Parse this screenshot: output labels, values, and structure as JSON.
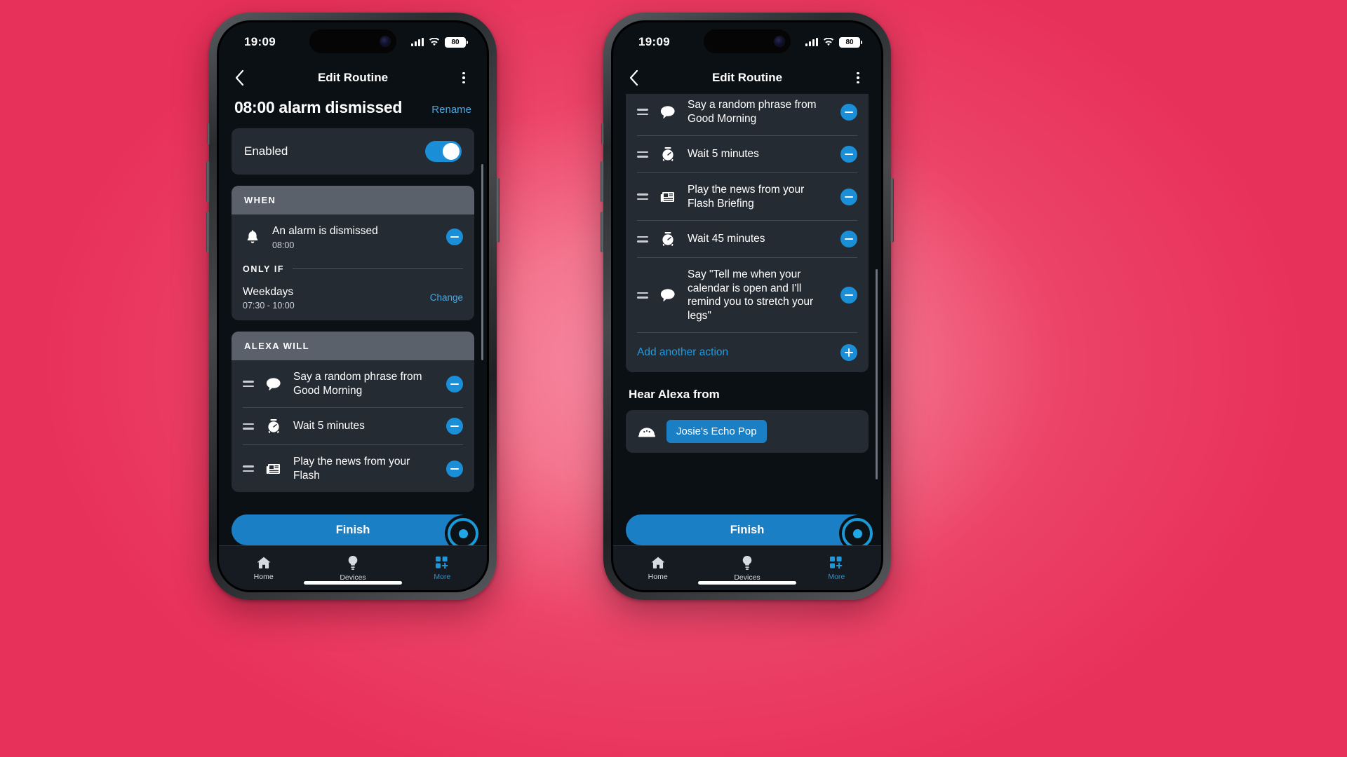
{
  "status_bar": {
    "time": "19:09",
    "battery": "80",
    "signal_icon": "cellular-signal-icon",
    "wifi_icon": "wifi-icon"
  },
  "nav": {
    "title": "Edit Routine",
    "back_icon": "back-chevron-icon",
    "more_icon": "overflow-menu-icon"
  },
  "left_phone": {
    "routine_name": "08:00 alarm dismissed",
    "rename_label": "Rename",
    "enabled": {
      "label": "Enabled",
      "state": "on"
    },
    "when": {
      "header": "WHEN",
      "trigger": {
        "icon": "bell-icon",
        "title": "An alarm is dismissed",
        "subtitle": "08:00",
        "remove_label": "−"
      },
      "only_if_header": "ONLY IF",
      "condition": {
        "title": "Weekdays",
        "subtitle": "07:30 - 10:00",
        "change_label": "Change"
      }
    },
    "alexa_will": {
      "header": "ALEXA WILL",
      "actions": [
        {
          "icon": "speech-bubble-icon",
          "title": "Say a random phrase from Good Morning"
        },
        {
          "icon": "alarm-clock-icon",
          "title": "Wait 5 minutes"
        },
        {
          "icon": "newspaper-icon",
          "title": "Play the news from your Flash"
        }
      ]
    },
    "finish_label": "Finish"
  },
  "right_phone": {
    "actions": [
      {
        "icon": "speech-bubble-icon",
        "title": "Say a random phrase from Good Morning"
      },
      {
        "icon": "alarm-clock-icon",
        "title": "Wait 5 minutes"
      },
      {
        "icon": "newspaper-icon",
        "title": "Play the news from your Flash Briefing"
      },
      {
        "icon": "alarm-clock-icon",
        "title": "Wait 45 minutes"
      },
      {
        "icon": "speech-bubble-icon",
        "title": "Say \"Tell me when your calendar is open and I'll remind you to stretch your legs\""
      }
    ],
    "add_action_label": "Add another action",
    "hear_alexa_from": {
      "header": "Hear Alexa from",
      "device_icon": "echo-pop-icon",
      "device_label": "Josie's Echo Pop"
    },
    "finish_label": "Finish"
  },
  "tabbar": {
    "tabs": [
      {
        "label": "Home",
        "icon": "home-icon",
        "active": false
      },
      {
        "label": "Devices",
        "icon": "bulb-icon",
        "active": false
      },
      {
        "label": "More",
        "icon": "more-grid-icon",
        "active": true
      }
    ]
  },
  "colors": {
    "accent": "#1a8fd8",
    "link": "#4aa8e0",
    "card": "#252b33",
    "card_header": "#5a616b",
    "screen_bg": "#0b1014",
    "background_pink": "#ec4368"
  }
}
